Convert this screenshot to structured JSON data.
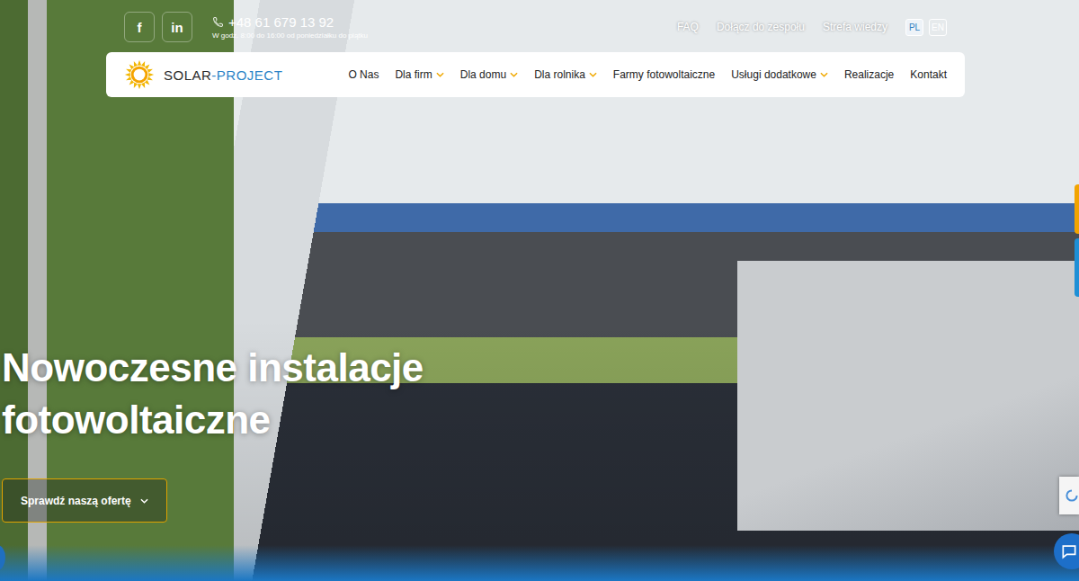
{
  "topbar": {
    "social": [
      {
        "name": "facebook",
        "label": "f"
      },
      {
        "name": "linkedin",
        "label": "in"
      }
    ],
    "phone": "+48 61 679 13 92",
    "hours": "W godz. 8:00 do 16:00 od poniedziałku do piątku",
    "links": [
      "FAQ",
      "Dołącz do zespołu",
      "Strefa wiedzy"
    ],
    "languages": [
      {
        "label": "PL",
        "selected": true
      },
      {
        "label": "EN",
        "selected": false
      }
    ]
  },
  "nav": {
    "logo": {
      "primary": "SOLAR",
      "secondary": "-PROJECT"
    },
    "items": [
      {
        "label": "O Nas",
        "dropdown": false
      },
      {
        "label": "Dla firm",
        "dropdown": true
      },
      {
        "label": "Dla domu",
        "dropdown": true
      },
      {
        "label": "Dla rolnika",
        "dropdown": true
      },
      {
        "label": "Farmy fotowoltaiczne",
        "dropdown": false
      },
      {
        "label": "Usługi dodatkowe",
        "dropdown": true
      },
      {
        "label": "Realizacje",
        "dropdown": false
      },
      {
        "label": "Kontakt",
        "dropdown": false
      }
    ]
  },
  "hero": {
    "heading": [
      "Nowoczesne instalacje",
      "fotowoltaiczne"
    ],
    "button": "Sprawdź naszą ofertę"
  }
}
